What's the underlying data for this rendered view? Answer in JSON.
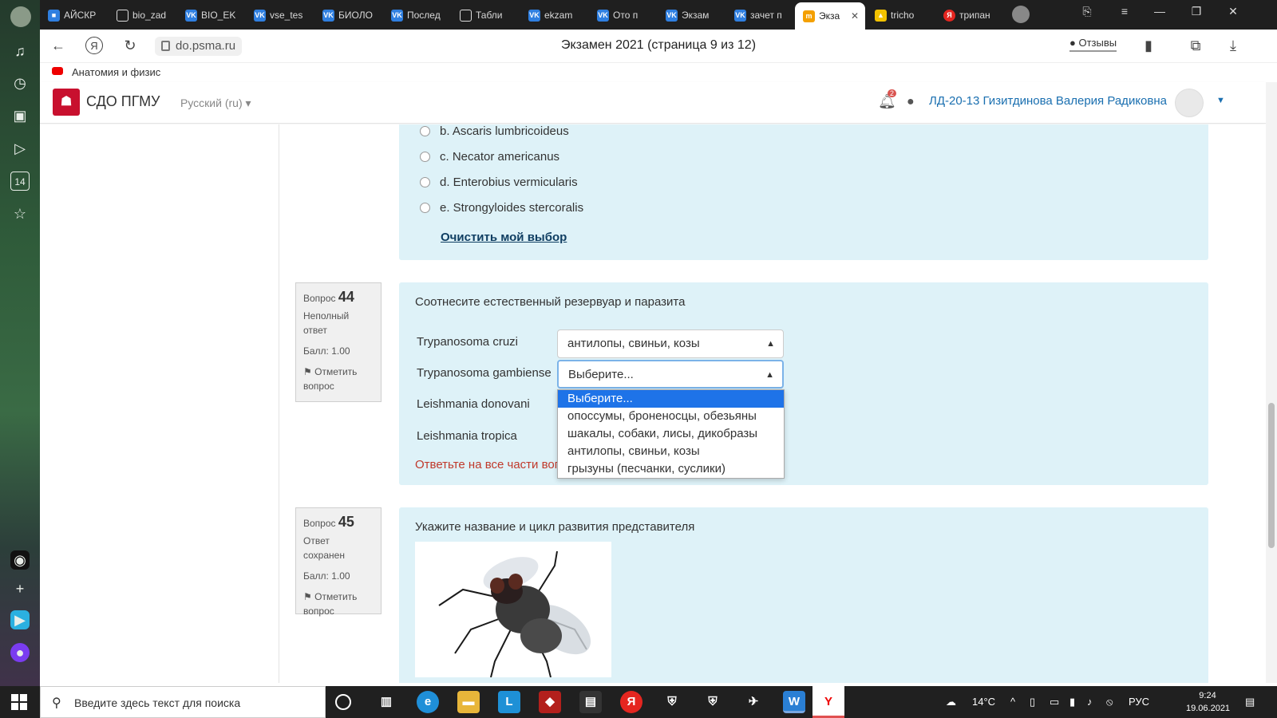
{
  "browser": {
    "tabs": [
      {
        "label": "АЙСКР"
      },
      {
        "label": "bio_zad"
      },
      {
        "label": "BIO_EK"
      },
      {
        "label": "vse_tes"
      },
      {
        "label": "БИОЛО"
      },
      {
        "label": "Послед"
      },
      {
        "label": "Табли"
      },
      {
        "label": "ekzam"
      },
      {
        "label": "Ото п"
      },
      {
        "label": "Экзам"
      },
      {
        "label": "зачет п"
      },
      {
        "label": "Экза"
      },
      {
        "label": "tricho"
      },
      {
        "label": "трипан"
      }
    ],
    "url": "do.psma.ru",
    "page_title": "Экзамен 2021 (страница 9 из 12)",
    "reviews_label": "Отзывы",
    "bookmark_label": "Анатомия и физис"
  },
  "site": {
    "name": "СДО ПГМУ",
    "language": "Русский (ru)",
    "notifications_count": "2",
    "user_name": "ЛД-20-13 Гизитдинова Валерия Радиковна"
  },
  "prev_question": {
    "options": [
      {
        "label": "b. Ascaris lumbricoideus"
      },
      {
        "label": "c. Necator americanus"
      },
      {
        "label": "d. Enterobius vermicularis"
      },
      {
        "label": "e. Strongyloides stercoralis"
      }
    ],
    "clear_label": "Очистить мой выбор"
  },
  "q44": {
    "prefix": "Вопрос",
    "number": "44",
    "status": "Неполный ответ",
    "grade": "Балл: 1.00",
    "flag": "Отметить вопрос",
    "text": "Соотнесите естественный резервуар и паразита",
    "stems": [
      {
        "label": "Trypanosoma cruzi"
      },
      {
        "label": "Trypanosoma gambiense"
      },
      {
        "label": "Leishmania donovani"
      },
      {
        "label": "Leishmania tropica"
      }
    ],
    "select1_value": "антилопы, свиньи, козы",
    "select2_value": "Выберите...",
    "dropdown_options": [
      {
        "label": "Выберите..."
      },
      {
        "label": "опоссумы, броненосцы, обезьяны"
      },
      {
        "label": "шакалы, собаки, лисы, дикобразы"
      },
      {
        "label": "антилопы, свиньи, козы"
      },
      {
        "label": "грызуны (песчанки, суслики)"
      }
    ],
    "warning": "Ответьте на все части вопроса."
  },
  "q45": {
    "prefix": "Вопрос",
    "number": "45",
    "status": "Ответ сохранен",
    "grade": "Балл: 1.00",
    "flag": "Отметить вопрос",
    "text": "Укажите название и цикл развития представителя"
  },
  "taskbar": {
    "search_placeholder": "Введите здесь текст для поиска",
    "temperature": "14°C",
    "language": "РУС",
    "time": "9:24",
    "date": "19.06.2021"
  }
}
